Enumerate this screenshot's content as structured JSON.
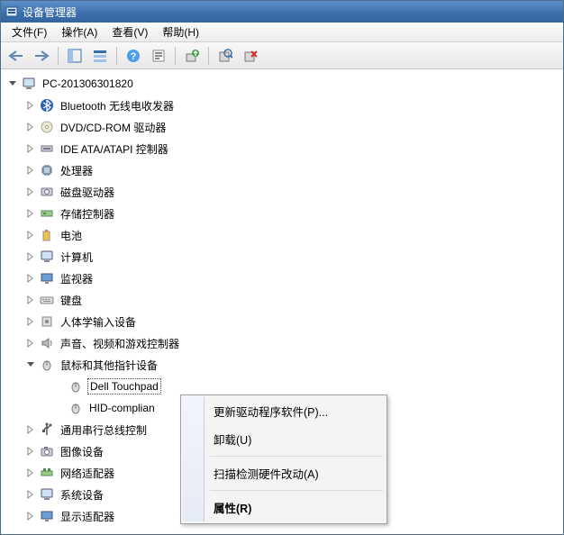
{
  "title": "设备管理器",
  "menubar": {
    "file": "文件(F)",
    "action": "操作(A)",
    "view": "查看(V)",
    "help": "帮助(H)"
  },
  "tree": {
    "root": "PC-201306301820",
    "nodes": {
      "bluetooth": "Bluetooth 无线电收发器",
      "dvd": "DVD/CD-ROM 驱动器",
      "ide": "IDE ATA/ATAPI 控制器",
      "cpu": "处理器",
      "disk": "磁盘驱动器",
      "storage": "存储控制器",
      "battery": "电池",
      "computer": "计算机",
      "monitor": "监视器",
      "keyboard": "键盘",
      "hid": "人体学输入设备",
      "sound": "声音、视频和游戏控制器",
      "mouse_cat": "鼠标和其他指针设备",
      "dell_touchpad": "Dell Touchpad",
      "hid_compliant": "HID-complian",
      "usb": "通用串行总线控制",
      "imaging": "图像设备",
      "network": "网络适配器",
      "system": "系统设备",
      "display": "显示适配器"
    }
  },
  "context_menu": {
    "update_driver": "更新驱动程序软件(P)...",
    "uninstall": "卸载(U)",
    "scan_hw": "扫描检测硬件改动(A)",
    "properties": "属性(R)"
  }
}
